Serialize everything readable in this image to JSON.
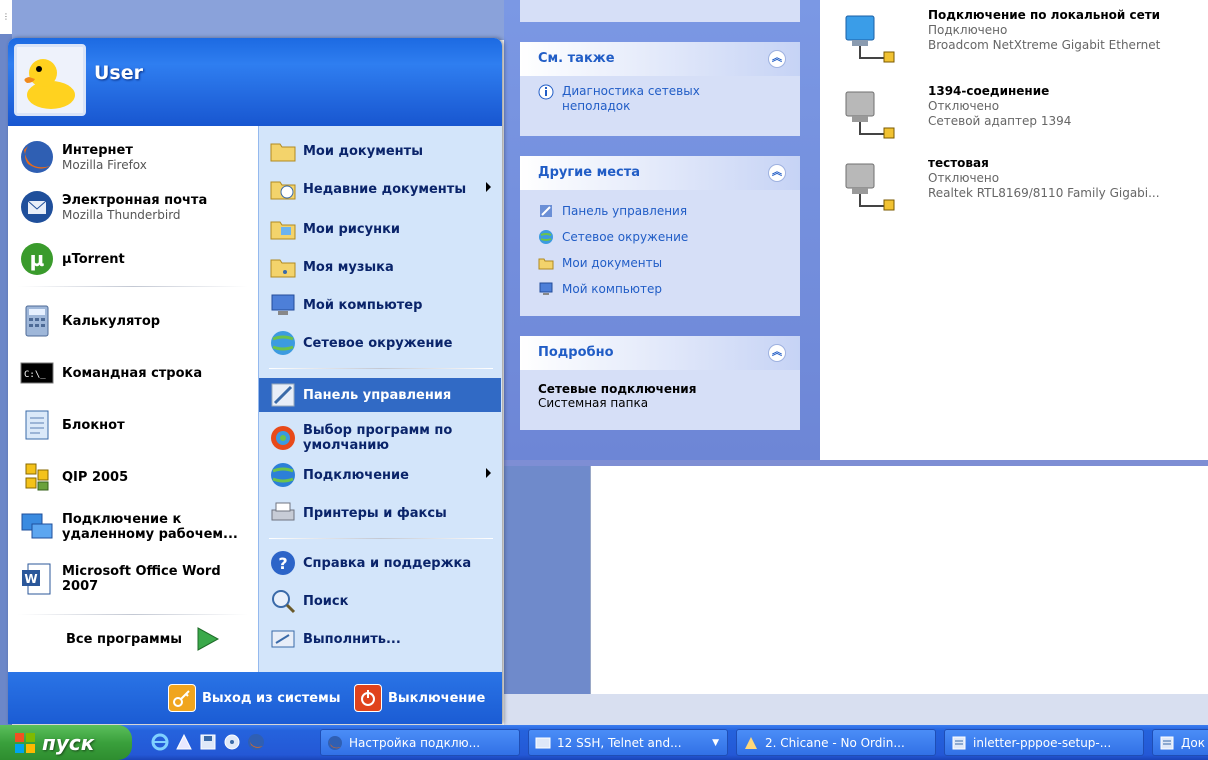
{
  "start_menu": {
    "user_name": "User",
    "pinned": [
      {
        "name": "Интернет",
        "sub": "Mozilla Firefox"
      },
      {
        "name": "Электронная почта",
        "sub": "Mozilla Thunderbird"
      }
    ],
    "recent": [
      {
        "name": "µTorrent"
      },
      {
        "name": "Калькулятор"
      },
      {
        "name": "Командная строка"
      },
      {
        "name": "Блокнот"
      },
      {
        "name": "QIP 2005"
      },
      {
        "name": "Подключение к удаленному рабочем..."
      },
      {
        "name": "Microsoft Office Word 2007"
      }
    ],
    "all_programs": "Все программы",
    "right_items": [
      {
        "label": "Мои документы"
      },
      {
        "label": "Недавние документы"
      },
      {
        "label": "Мои рисунки"
      },
      {
        "label": "Моя музыка"
      },
      {
        "label": "Мой компьютер"
      },
      {
        "label": "Сетевое окружение"
      },
      {
        "label": "Панель управления"
      },
      {
        "label": "Выбор программ по умолчанию"
      },
      {
        "label": "Подключение"
      },
      {
        "label": "Принтеры и факсы"
      },
      {
        "label": "Справка и поддержка"
      },
      {
        "label": "Поиск"
      },
      {
        "label": "Выполнить..."
      }
    ],
    "logoff": "Выход из системы",
    "shutdown": "Выключение"
  },
  "task_pane": {
    "see_also": {
      "title": "См. также",
      "links": [
        "Диагностика сетевых неполадок"
      ]
    },
    "other_places": {
      "title": "Другие места",
      "links": [
        "Панель управления",
        "Сетевое окружение",
        "Мои документы",
        "Мой компьютер"
      ]
    },
    "details": {
      "title": "Подробно",
      "name": "Сетевые подключения",
      "type": "Системная папка"
    }
  },
  "connections": [
    {
      "name": "Подключение по локальной сети",
      "status": "Подключено",
      "device": "Broadcom NetXtreme Gigabit Ethernet"
    },
    {
      "name": "1394-соединение",
      "status": "Отключено",
      "device": "Сетевой адаптер 1394"
    },
    {
      "name": "тестовая",
      "status": "Отключено",
      "device": "Realtek RTL8169/8110 Family Gigabi..."
    }
  ],
  "taskbar": {
    "start_label": "пуск",
    "buttons": [
      {
        "label": "Настройка подклю..."
      },
      {
        "label": "12 SSH, Telnet and..."
      },
      {
        "label": "2. Chicane - No Ordin..."
      },
      {
        "label": "inletter-pppoe-setup-..."
      },
      {
        "label": "Док"
      }
    ]
  }
}
